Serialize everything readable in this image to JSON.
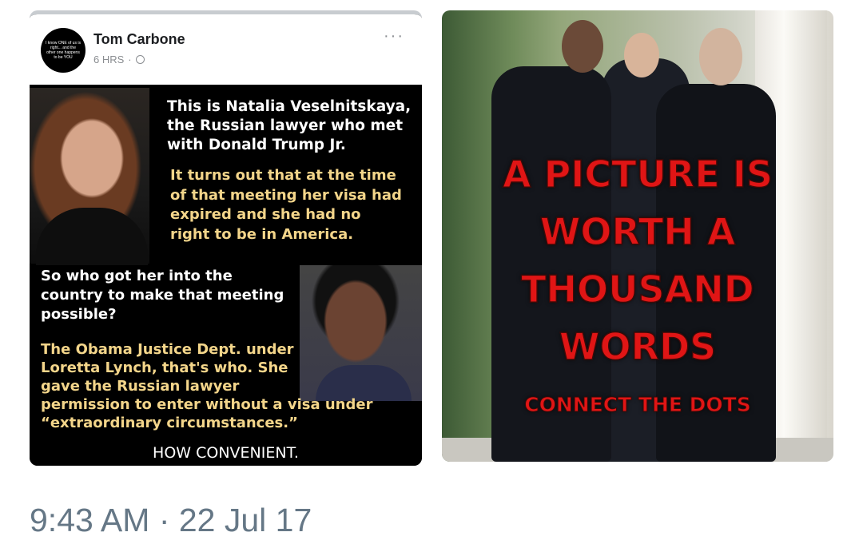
{
  "left_image": {
    "author_name": "Tom Carbone",
    "post_time": "6 HRS",
    "avatar_text": "I know ONE of us is right... and the other one happens to be YOU",
    "more_icon": "···",
    "meme": {
      "intro": [
        "This is Natalia Veselnitskaya,",
        "the Russian lawyer who met",
        "with Donald Trump Jr."
      ],
      "visa": [
        "It turns out that at the time",
        "of that meeting her visa had",
        "expired and she had no",
        "right to be in America."
      ],
      "question": [
        "So who got her into the",
        "country to make that meeting",
        "possible?"
      ],
      "answer": [
        "The Obama Justice Dept. under",
        "Loretta Lynch, that's who.  She",
        "gave the Russian lawyer",
        "permission to enter without a visa under",
        "“extraordinary circumstances.”"
      ],
      "closing": "HOW CONVENIENT."
    }
  },
  "right_image": {
    "caption_lines": [
      "A PICTURE IS",
      "WORTH A",
      "THOUSAND",
      "WORDS"
    ],
    "subcaption": "CONNECT THE DOTS"
  },
  "timestamp": "9:43 AM · 22 Jul 17",
  "colors": {
    "caption_red": "#e01515",
    "meme_yellow": "#f3d58a",
    "timestamp_gray": "#657786"
  }
}
